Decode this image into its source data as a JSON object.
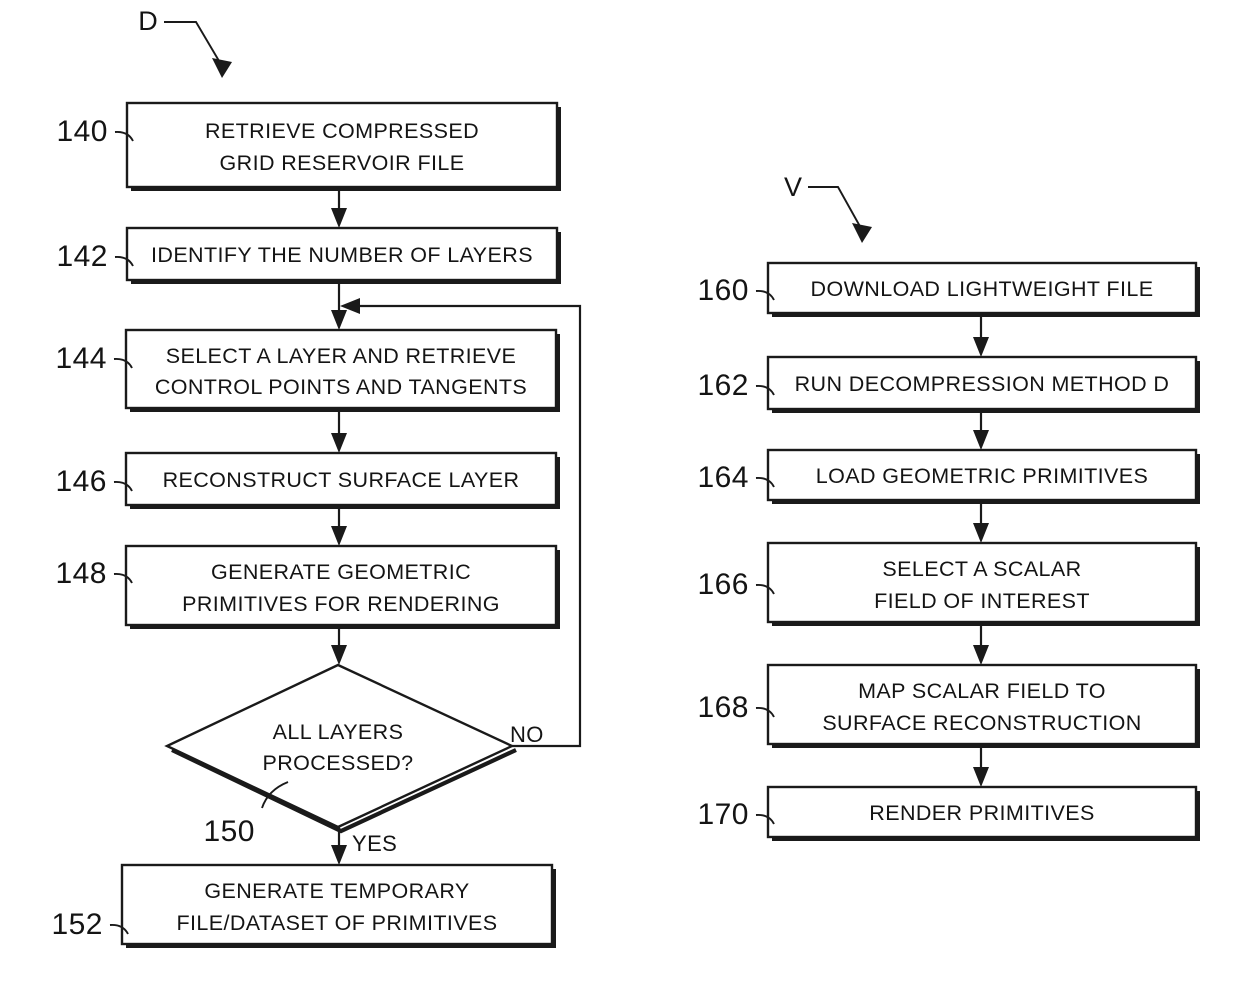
{
  "figure": {
    "type": "patent-flowchart",
    "background_color": "#ffffff",
    "line_color": "#1a1a1a"
  },
  "flowcharts": [
    {
      "id": "decompression-method",
      "tag": "D",
      "steps": [
        {
          "ref": "140",
          "lines": [
            "RETRIEVE COMPRESSED",
            "GRID RESERVOIR FILE"
          ],
          "shape": "process"
        },
        {
          "ref": "142",
          "lines": [
            "IDENTIFY THE NUMBER OF LAYERS"
          ],
          "shape": "process"
        },
        {
          "ref": "144",
          "lines": [
            "SELECT A LAYER AND RETRIEVE",
            "CONTROL POINTS AND TANGENTS"
          ],
          "shape": "process"
        },
        {
          "ref": "146",
          "lines": [
            "RECONSTRUCT SURFACE LAYER"
          ],
          "shape": "process"
        },
        {
          "ref": "148",
          "lines": [
            "GENERATE GEOMETRIC",
            "PRIMITIVES FOR RENDERING"
          ],
          "shape": "process"
        },
        {
          "ref": "150",
          "lines": [
            "ALL LAYERS",
            "PROCESSED?"
          ],
          "shape": "decision",
          "branch_no": "NO",
          "branch_yes": "YES"
        },
        {
          "ref": "152",
          "lines": [
            "GENERATE TEMPORARY",
            "FILE/DATASET OF PRIMITIVES"
          ],
          "shape": "process"
        }
      ]
    },
    {
      "id": "visualization-method",
      "tag": "V",
      "steps": [
        {
          "ref": "160",
          "lines": [
            "DOWNLOAD LIGHTWEIGHT FILE"
          ],
          "shape": "process"
        },
        {
          "ref": "162",
          "lines": [
            "RUN DECOMPRESSION METHOD D"
          ],
          "shape": "process"
        },
        {
          "ref": "164",
          "lines": [
            "LOAD GEOMETRIC PRIMITIVES"
          ],
          "shape": "process"
        },
        {
          "ref": "166",
          "lines": [
            "SELECT A SCALAR",
            "FIELD OF INTEREST"
          ],
          "shape": "process"
        },
        {
          "ref": "168",
          "lines": [
            "MAP SCALAR FIELD TO",
            "SURFACE RECONSTRUCTION"
          ],
          "shape": "process"
        },
        {
          "ref": "170",
          "lines": [
            "RENDER PRIMITIVES"
          ],
          "shape": "process"
        }
      ]
    }
  ]
}
